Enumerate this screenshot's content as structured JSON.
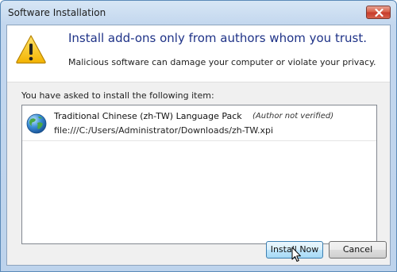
{
  "window": {
    "title": "Software Installation"
  },
  "header": {
    "headline": "Install add-ons only from authors whom you trust.",
    "subtext": "Malicious software can damage your computer or violate your privacy."
  },
  "body": {
    "intro": "You have asked to install the following item:",
    "items": [
      {
        "name": "Traditional Chinese (zh-TW) Language Pack",
        "author_note": "(Author not verified)",
        "path": "file:///C:/Users/Administrator/Downloads/zh-TW.xpi"
      }
    ]
  },
  "buttons": {
    "install": "Install Now",
    "cancel": "Cancel"
  },
  "icons": {
    "close": "close-icon",
    "warning": "warning-icon",
    "globe": "globe-icon",
    "cursor": "mouse-cursor-icon"
  },
  "colors": {
    "headline": "#1e3287",
    "close_button": "#c7392a",
    "default_button_border": "#3c7fb1"
  }
}
